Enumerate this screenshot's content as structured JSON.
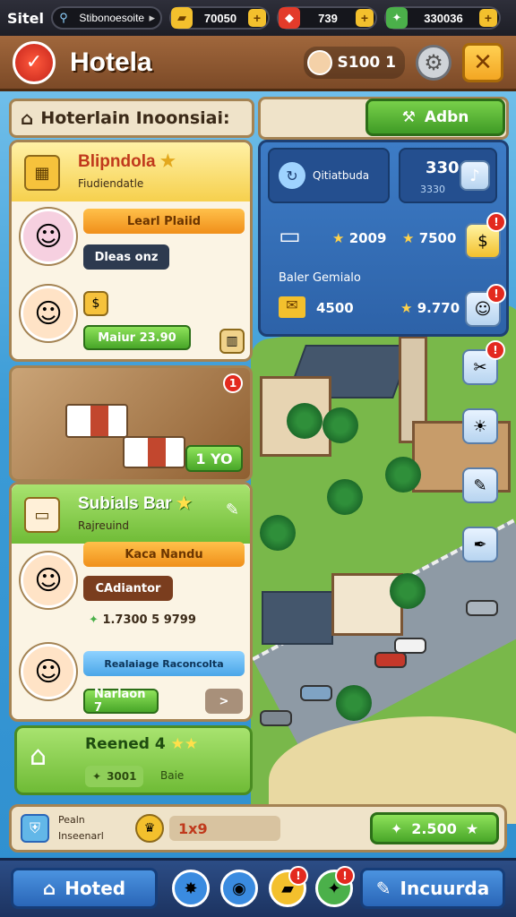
{
  "topbar": {
    "title": "Sitel",
    "search_value": "Stibonoesoite",
    "res1_value": "70050",
    "res2_value": "739",
    "res3_value": "330036"
  },
  "header": {
    "title": "Hotela",
    "cash": "S100 1"
  },
  "section": {
    "title": "Hoterlain Inoonsiai:",
    "add_label": "Adbn"
  },
  "card1": {
    "title": "Blipndola",
    "subtitle": "Fiudiendatle",
    "pill_orange": "Learl Plaiid",
    "pill_dark": "Dleas onz",
    "coin_label": "$",
    "green_label": "Maiur 23.90"
  },
  "room": {
    "button_label": "1 YO",
    "badge": "1"
  },
  "card2": {
    "title": "Subials Bar",
    "subtitle": "Rajreuind",
    "pill_orange": "Kaca Nandu",
    "pill_brown": "CAdiantor",
    "stat": "1.7300 5 9799",
    "pill_blue": "Realaiage Raconcolta",
    "green_label": "Narlaon 7",
    "arrow_label": ">"
  },
  "reward": {
    "title": "Reened 4",
    "value": "3001",
    "tag": "Baie"
  },
  "rpanel": {
    "tile_label": "Qitiatbuda",
    "tile2_value": "330",
    "tile2_sub": "3330",
    "stat1": "2009",
    "stat2": "7500",
    "caption": "Baler Gemialo",
    "stat3": "4500",
    "stat4": "9.770"
  },
  "status": {
    "left_label_1": "Pealn",
    "left_label_2": "Inseenarl",
    "mid_value": "1x9",
    "right_value": "2.500"
  },
  "nav": {
    "left_label": "Hoted",
    "right_label": "Incuurda"
  },
  "colors": {
    "wood": "#a0673c",
    "panel": "#efe3c9",
    "green": "#48a628",
    "blue": "#2a66b8",
    "alert": "#e3291e"
  }
}
